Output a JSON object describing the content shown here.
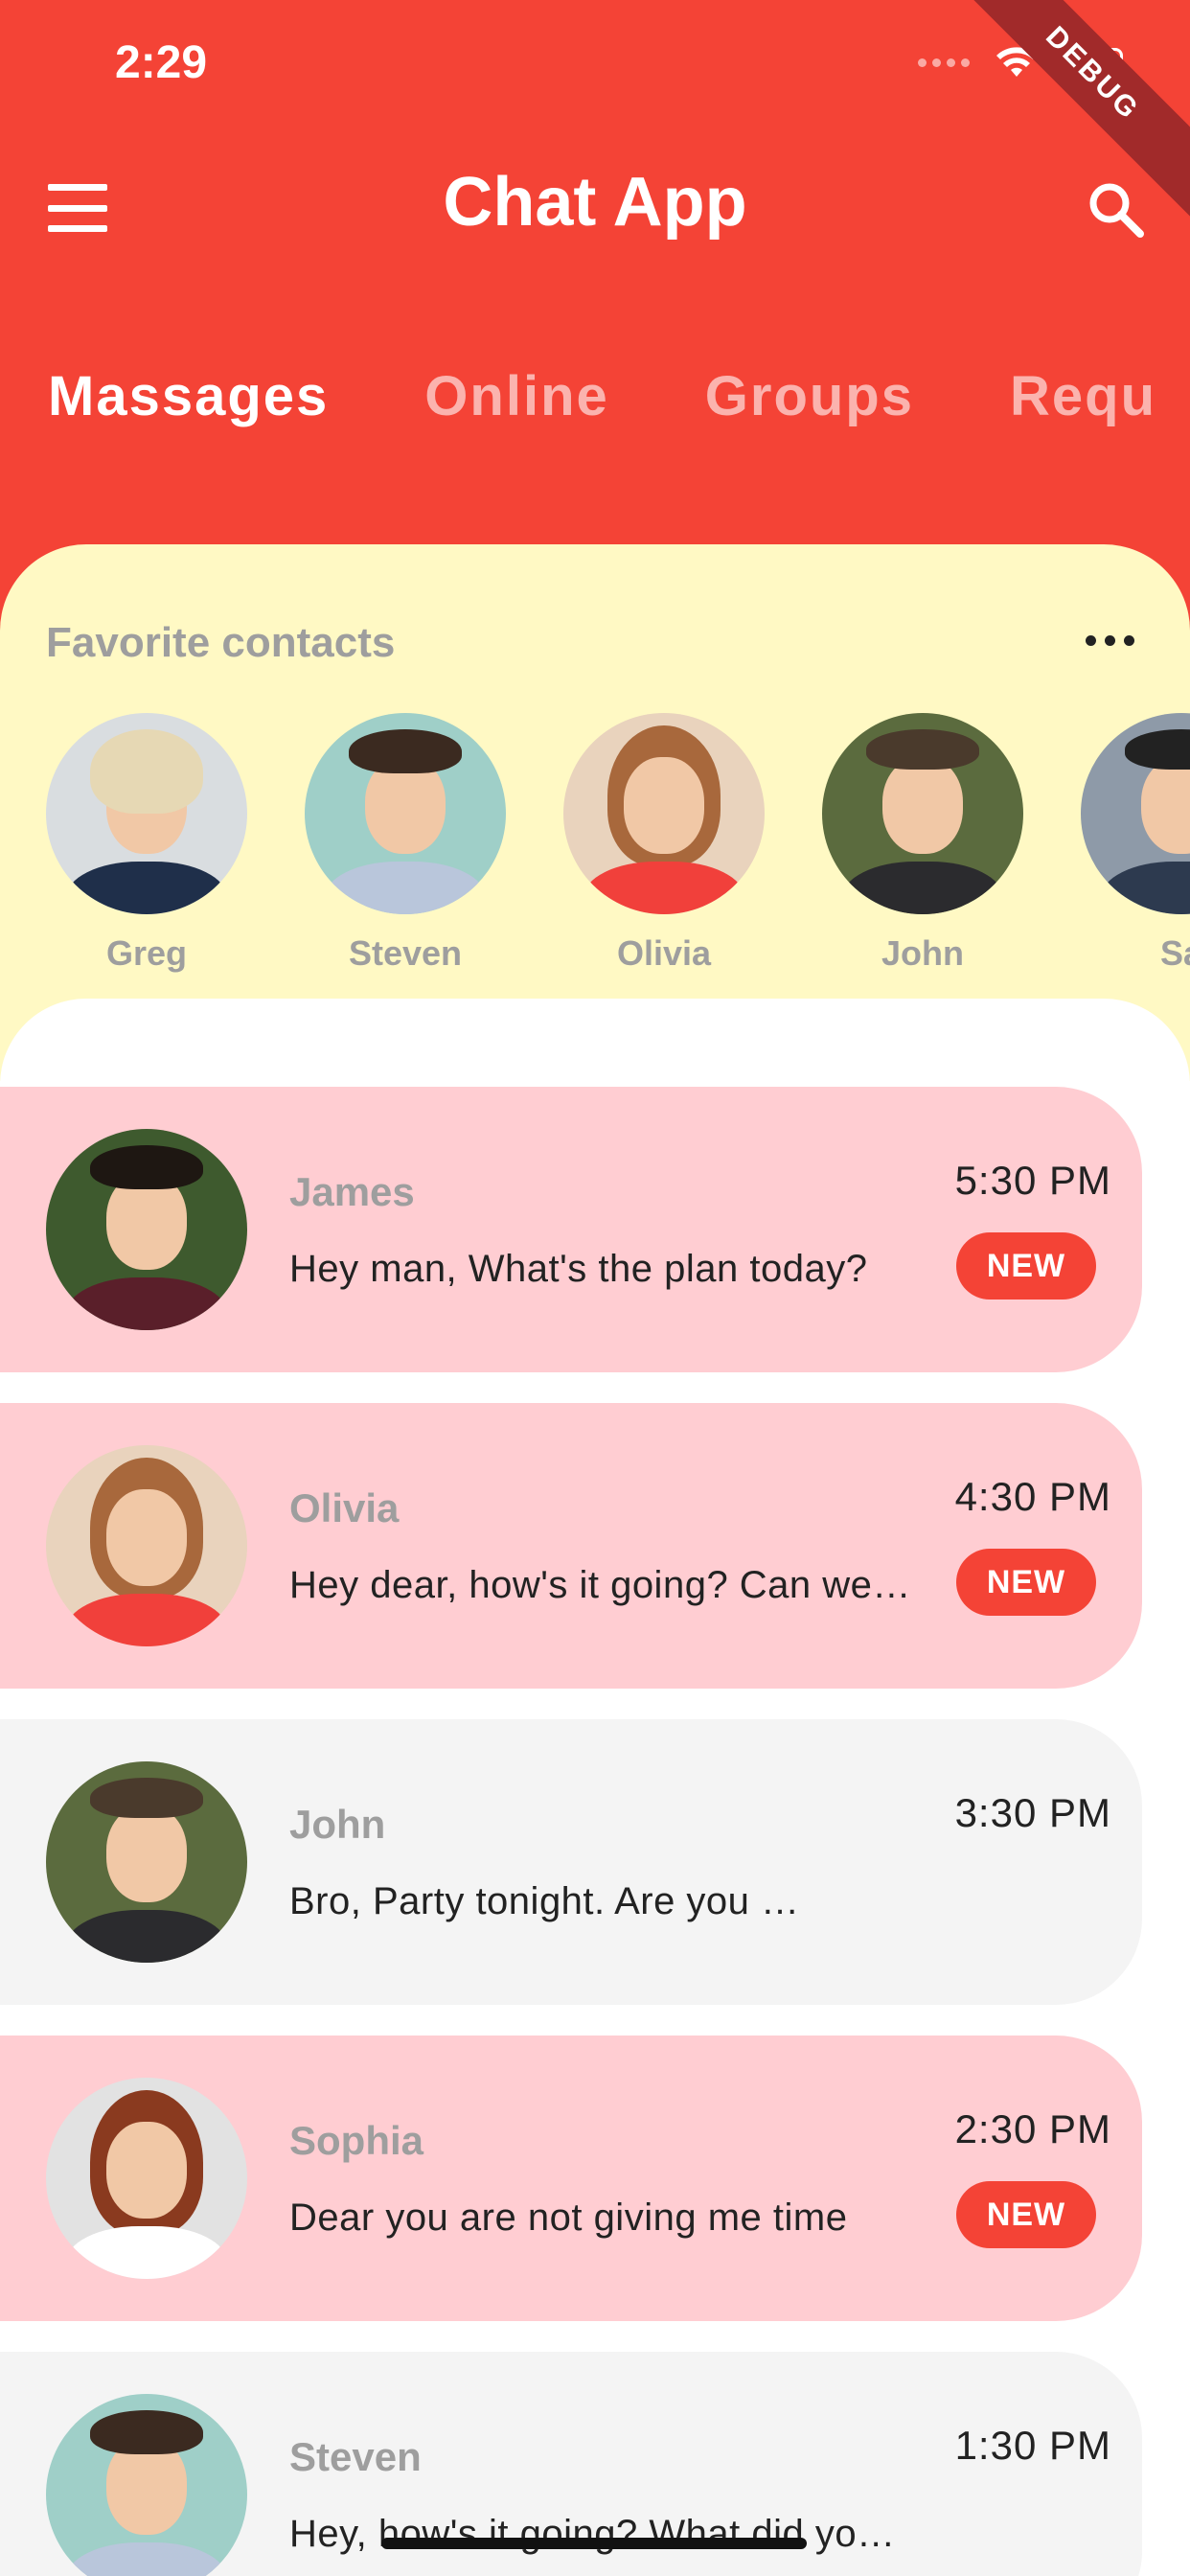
{
  "status_bar": {
    "time": "2:29"
  },
  "debug_banner": "DEBUG",
  "header": {
    "title": "Chat App",
    "menu_icon": "menu-icon",
    "search_icon": "search-icon"
  },
  "tabs": [
    {
      "label": "Massages",
      "active": true
    },
    {
      "label": "Online",
      "active": false
    },
    {
      "label": "Groups",
      "active": false
    },
    {
      "label": "Requ",
      "active": false
    }
  ],
  "favorites": {
    "title": "Favorite contacts",
    "more_icon": "more-horizontal-icon",
    "contacts": [
      {
        "name": "Greg"
      },
      {
        "name": "Steven"
      },
      {
        "name": "Olivia"
      },
      {
        "name": "John"
      },
      {
        "name": "Sa"
      }
    ]
  },
  "chats": [
    {
      "name": "James",
      "message": "Hey man, What's the plan today?",
      "time": "5:30 PM",
      "unread": true,
      "badge": "NEW"
    },
    {
      "name": "Olivia",
      "message": "Hey dear, how's it going? Can we…",
      "time": "4:30 PM",
      "unread": true,
      "badge": "NEW"
    },
    {
      "name": "John",
      "message": "Bro, Party tonight. Are you …",
      "time": "3:30 PM",
      "unread": false,
      "badge": ""
    },
    {
      "name": "Sophia",
      "message": "Dear you are not giving me time",
      "time": "2:30 PM",
      "unread": true,
      "badge": "NEW"
    },
    {
      "name": "Steven",
      "message": "Hey, how's it going? What did yo…",
      "time": "1:30 PM",
      "unread": false,
      "badge": ""
    }
  ],
  "colors": {
    "primary": "#f44336",
    "favorites_bg": "#fff9c4",
    "unread_bg": "#ffcdd2",
    "read_bg": "#f4f4f4",
    "muted_text": "#9e9e9e"
  }
}
